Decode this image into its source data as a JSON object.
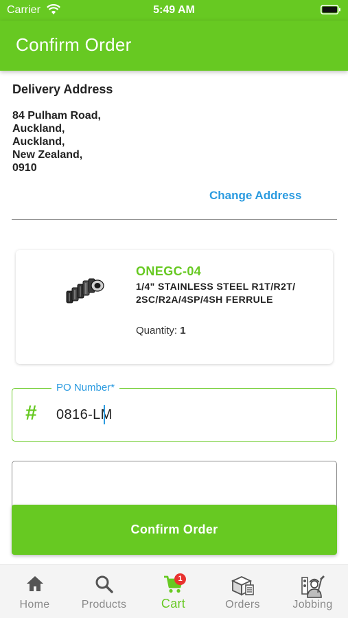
{
  "status_bar": {
    "carrier": "Carrier",
    "time": "5:49 AM"
  },
  "app_bar": {
    "title": "Confirm Order"
  },
  "delivery": {
    "heading": "Delivery Address",
    "address_lines": [
      "84 Pulham Road,",
      "Auckland,",
      "Auckland,",
      "New Zealand,",
      "0910"
    ],
    "change_label": "Change Address"
  },
  "product": {
    "code": "ONEGC-04",
    "name": "1/4\" STAINLESS STEEL R1T/R2T/ 2SC/R2A/4SP/4SH FERRULE",
    "qty_label": "Quantity:",
    "qty_value": "1"
  },
  "po": {
    "label": "PO Number*",
    "value": "0816-LM"
  },
  "confirm_button": {
    "label": "Confirm Order"
  },
  "nav": {
    "items": [
      {
        "label": "Home",
        "icon": "home-icon"
      },
      {
        "label": "Products",
        "icon": "search-icon"
      },
      {
        "label": "Cart",
        "icon": "cart-icon",
        "badge": "1",
        "active": true
      },
      {
        "label": "Orders",
        "icon": "orders-box-icon"
      },
      {
        "label": "Jobbing",
        "icon": "jobbing-worker-icon"
      }
    ]
  },
  "colors": {
    "brand_green": "#67c922",
    "link_blue": "#2b9be0",
    "badge_red": "#e8322f"
  }
}
